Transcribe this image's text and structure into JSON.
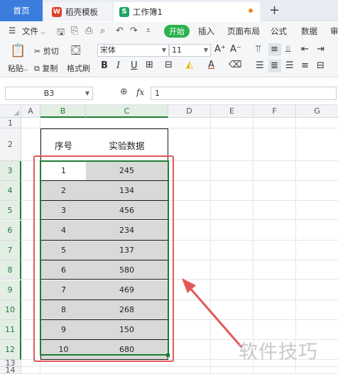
{
  "tabs": {
    "home": "首页",
    "template": "稻壳模板",
    "workbook": "工作簿1",
    "template_icon": "W",
    "workbook_icon": "S",
    "new_tab": "+"
  },
  "menu": {
    "file": "文件",
    "start": "开始",
    "insert": "插入",
    "page_layout": "页面布局",
    "formula": "公式",
    "data": "数据",
    "review_partial": "审"
  },
  "ribbon": {
    "cut": "剪切",
    "copy": "复制",
    "paste": "粘贴",
    "format_painter": "格式刷",
    "font_name": "宋体",
    "font_size": "11",
    "bold": "B",
    "italic": "I",
    "underline": "U"
  },
  "formula_bar": {
    "name_box": "B3",
    "fx_label": "fx",
    "value": "1"
  },
  "grid": {
    "columns": [
      "A",
      "B",
      "C",
      "D",
      "E",
      "F",
      "G"
    ],
    "rows": [
      "1",
      "2",
      "3",
      "4",
      "5",
      "6",
      "7",
      "8",
      "9",
      "10",
      "11",
      "12",
      "13",
      "14"
    ],
    "header_b": "序号",
    "header_c": "实验数据",
    "data_rows": [
      {
        "idx": "1",
        "val": "245"
      },
      {
        "idx": "2",
        "val": "134"
      },
      {
        "idx": "3",
        "val": "456"
      },
      {
        "idx": "4",
        "val": "234"
      },
      {
        "idx": "5",
        "val": "137"
      },
      {
        "idx": "6",
        "val": "580"
      },
      {
        "idx": "7",
        "val": "469"
      },
      {
        "idx": "8",
        "val": "268"
      },
      {
        "idx": "9",
        "val": "150"
      },
      {
        "idx": "10",
        "val": "680"
      }
    ]
  },
  "watermark": "软件技巧",
  "colors": {
    "selection": "#1e7e34",
    "annotation": "#e35858",
    "shade": "#d9d9d9",
    "start_button": "#2bb24c"
  }
}
